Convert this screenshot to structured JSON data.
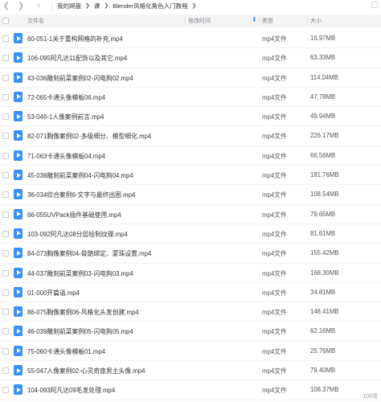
{
  "toolbar": {
    "breadcrumb": [
      "我的网盘",
      "课",
      "Blender风格化角色入门教程"
    ]
  },
  "columns": {
    "name": "文件名",
    "modified": "修改时间",
    "type": "类型",
    "size": "大小"
  },
  "files": [
    {
      "name": "60-051-1关于重构网格的补充.mp4",
      "type": "mp4文件",
      "size": "16.97MB"
    },
    {
      "name": "106-095阿凡达11配饰以及其它.mp4",
      "type": "mp4文件",
      "size": "63.33MB"
    },
    {
      "name": "43-036雕刻前菜案例02-闪电狗02.mp4",
      "type": "mp4文件",
      "size": "114.04MB"
    },
    {
      "name": "72-065卡通头像模板06.mp4",
      "type": "mp4文件",
      "size": "47.78MB"
    },
    {
      "name": "53-046-1人像案例前言.mp4",
      "type": "mp4文件",
      "size": "49.94MB"
    },
    {
      "name": "82-071胸像案例02-多级细分、模型细化.mp4",
      "type": "mp4文件",
      "size": "226.17MB"
    },
    {
      "name": "71-063卡通头像模板04.mp4",
      "type": "mp4文件",
      "size": "66.56MB"
    },
    {
      "name": "45-038雕刻前菜案例04-闪电狗04.mp4",
      "type": "mp4文件",
      "size": "181.76MB"
    },
    {
      "name": "36-034综合案例6-文字与最终出图.mp4",
      "type": "mp4文件",
      "size": "108.54MB"
    },
    {
      "name": "66-055UVPack插件基础使用.mp4",
      "type": "mp4文件",
      "size": "79.65MB"
    },
    {
      "name": "103-092阿凡达08分层绘制纹理.mp4",
      "type": "mp4文件",
      "size": "81.61MB"
    },
    {
      "name": "84-073胸像案例04-骨骼绑定、蒙珠设置.mp4",
      "type": "mp4文件",
      "size": "155.42MB"
    },
    {
      "name": "44-037雕刻前菜案例03-闪电狗03.mp4",
      "type": "mp4文件",
      "size": "168.30MB"
    },
    {
      "name": "01-000开篇语.mp4",
      "type": "mp4文件",
      "size": "34.81MB"
    },
    {
      "name": "86-075胸像案例06-风格化头发创建.mp4",
      "type": "mp4文件",
      "size": "148.41MB"
    },
    {
      "name": "46-039雕刻前菜案例05-闪电狗05.mp4",
      "type": "mp4文件",
      "size": "62.16MB"
    },
    {
      "name": "75-060卡通头像模板01.mp4",
      "type": "mp4文件",
      "size": "25.76MB"
    },
    {
      "name": "55-047人像案例02-心灵奇旅男主头像.mp4",
      "type": "mp4文件",
      "size": "79.40MB"
    },
    {
      "name": "104-093阿凡达09毛发处理.mp4",
      "type": "mp4文件",
      "size": "108.37MB"
    }
  ],
  "status": {
    "count": "108项"
  },
  "colors": {
    "accent": "#3b91f2",
    "header_bg": "#f5f5f5"
  }
}
